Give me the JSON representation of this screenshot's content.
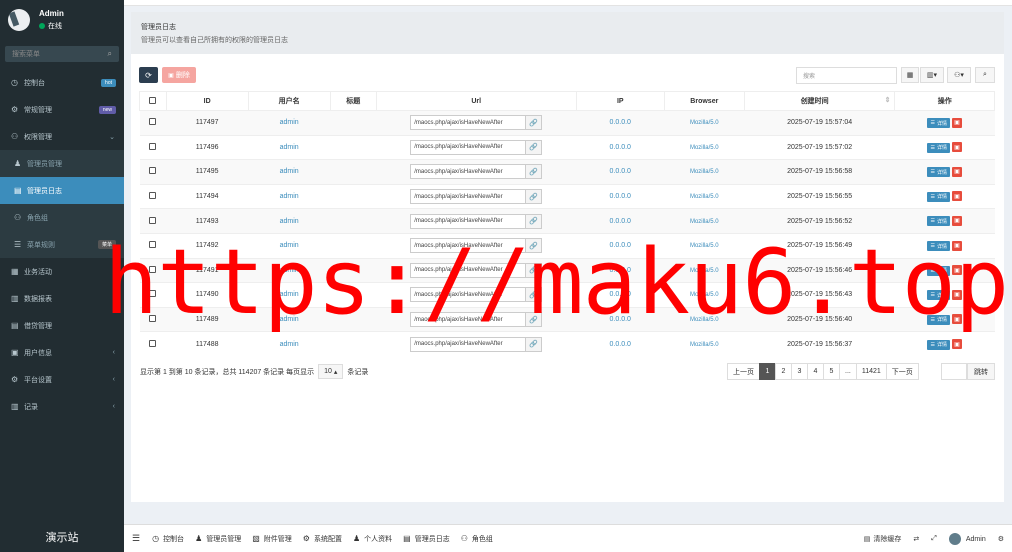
{
  "sidebar": {
    "user_name": "Admin",
    "user_status": "在线",
    "search_placeholder": "搜索菜单",
    "items": [
      {
        "label": "控制台",
        "icon": "dashboard-icon",
        "badge": "hot",
        "badge_color": "#3c8dbc"
      },
      {
        "label": "常规管理",
        "icon": "cogs-icon",
        "badge": "new",
        "badge_color": "#605ca8"
      },
      {
        "label": "权限管理",
        "icon": "group-icon",
        "expanded": true
      },
      {
        "label": "管理员管理",
        "icon": "user-icon",
        "sub": true
      },
      {
        "label": "管理员日志",
        "icon": "list-icon",
        "sub": true,
        "active": true
      },
      {
        "label": "角色组",
        "icon": "group-icon",
        "sub": true
      },
      {
        "label": "菜单规则",
        "icon": "bars-icon",
        "sub": true,
        "badge": "菜单",
        "badge_color": "#555"
      },
      {
        "label": "业务活动",
        "icon": "table-icon"
      },
      {
        "label": "数据报表",
        "icon": "file-icon"
      },
      {
        "label": "借贷管理",
        "icon": "list-icon"
      },
      {
        "label": "用户信息",
        "icon": "user-card-icon",
        "chevron": true
      },
      {
        "label": "平台设置",
        "icon": "gear-icon",
        "chevron": true
      },
      {
        "label": "记录",
        "icon": "bar-chart-icon",
        "chevron": true
      }
    ],
    "footer": "演示站"
  },
  "panel": {
    "title": "管理员日志",
    "subtitle": "管理员可以查看自己所拥有的权限的管理员日志"
  },
  "toolbar": {
    "refresh_icon": "refresh-icon",
    "delete_label": "删除",
    "search_placeholder": "搜索",
    "refresh_color": "#18bc9c",
    "refresh_bg": "#2c3e50",
    "delete_bg": "#f39c9c"
  },
  "table": {
    "headers": [
      "ID",
      "用户名",
      "标题",
      "Url",
      "IP",
      "Browser",
      "创建时间",
      "操作"
    ],
    "rows": [
      {
        "id": "117497",
        "user": "admin",
        "title": "",
        "url": "/maocs.php/ajax/isHaveNewAfter",
        "ip": "0.0.0.0",
        "browser": "Mozilla/5.0",
        "time": "2025-07-19 15:57:04"
      },
      {
        "id": "117496",
        "user": "admin",
        "title": "",
        "url": "/maocs.php/ajax/isHaveNewAfter",
        "ip": "0.0.0.0",
        "browser": "Mozilla/5.0",
        "time": "2025-07-19 15:57:02"
      },
      {
        "id": "117495",
        "user": "admin",
        "title": "",
        "url": "/maocs.php/ajax/isHaveNewAfter",
        "ip": "0.0.0.0",
        "browser": "Mozilla/5.0",
        "time": "2025-07-19 15:56:58"
      },
      {
        "id": "117494",
        "user": "admin",
        "title": "",
        "url": "/maocs.php/ajax/isHaveNewAfter",
        "ip": "0.0.0.0",
        "browser": "Mozilla/5.0",
        "time": "2025-07-19 15:56:55"
      },
      {
        "id": "117493",
        "user": "admin",
        "title": "",
        "url": "/maocs.php/ajax/isHaveNewAfter",
        "ip": "0.0.0.0",
        "browser": "Mozilla/5.0",
        "time": "2025-07-19 15:56:52"
      },
      {
        "id": "117492",
        "user": "admin",
        "title": "",
        "url": "/maocs.php/ajax/isHaveNewAfter",
        "ip": "0.0.0.0",
        "browser": "Mozilla/5.0",
        "time": "2025-07-19 15:56:49"
      },
      {
        "id": "117491",
        "user": "admin",
        "title": "",
        "url": "/maocs.php/ajax/isHaveNewAfter",
        "ip": "0.0.0.0",
        "browser": "Mozilla/5.0",
        "time": "2025-07-19 15:56:46"
      },
      {
        "id": "117490",
        "user": "admin",
        "title": "",
        "url": "/maocs.php/ajax/isHaveNewAfter",
        "ip": "0.0.0.0",
        "browser": "Mozilla/5.0",
        "time": "2025-07-19 15:56:43"
      },
      {
        "id": "117489",
        "user": "admin",
        "title": "",
        "url": "/maocs.php/ajax/isHaveNewAfter",
        "ip": "0.0.0.0",
        "browser": "Mozilla/5.0",
        "time": "2025-07-19 15:56:40"
      },
      {
        "id": "117488",
        "user": "admin",
        "title": "",
        "url": "/maocs.php/ajax/isHaveNewAfter",
        "ip": "0.0.0.0",
        "browser": "Mozilla/5.0",
        "time": "2025-07-19 15:56:37"
      }
    ],
    "detail_label": "详情"
  },
  "footer": {
    "summary_left": "显示第 1 到第 10 条记录，总共 114207 条记录 每页显示",
    "page_size": "10",
    "summary_right": "条记录",
    "pager": [
      "上一页",
      "1",
      "2",
      "3",
      "4",
      "5",
      "...",
      "11421",
      "下一页"
    ],
    "active_page": "1",
    "jump_label": "跳转"
  },
  "bottombar": {
    "tabs": [
      {
        "label": "控制台",
        "icon": "dashboard-icon"
      },
      {
        "label": "管理员管理",
        "icon": "user-icon"
      },
      {
        "label": "附件管理",
        "icon": "file-image-icon"
      },
      {
        "label": "系统配置",
        "icon": "gear-icon"
      },
      {
        "label": "个人资料",
        "icon": "user-icon"
      },
      {
        "label": "管理员日志",
        "icon": "list-icon"
      },
      {
        "label": "角色组",
        "icon": "group-icon"
      }
    ],
    "clear_cache": "清除缓存",
    "admin": "Admin"
  },
  "watermark": "https://maku6.top/"
}
